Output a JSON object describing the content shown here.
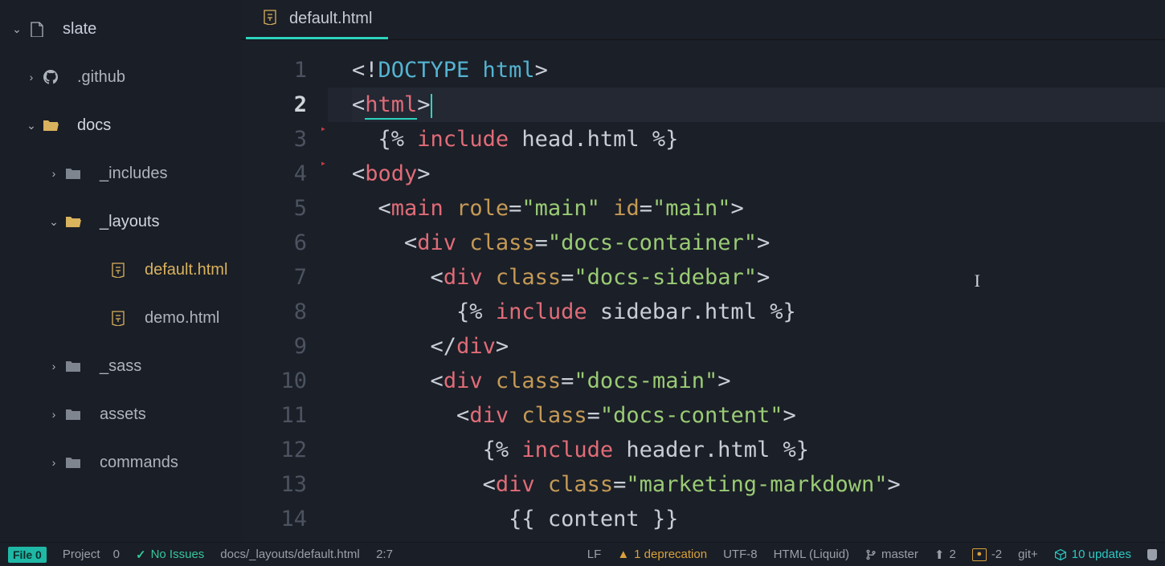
{
  "project": {
    "name": "slate"
  },
  "tree": [
    {
      "label": "slate",
      "depth": 0,
      "icon": "book",
      "arrow": "down",
      "kind": "root"
    },
    {
      "label": ".github",
      "depth": 1,
      "icon": "github",
      "arrow": "right",
      "kind": "folder-closed"
    },
    {
      "label": "docs",
      "depth": 1,
      "icon": "folder-open",
      "arrow": "down",
      "kind": "folder-open"
    },
    {
      "label": "_includes",
      "depth": 2,
      "icon": "folder-closed",
      "arrow": "right",
      "kind": "folder-closed"
    },
    {
      "label": "_layouts",
      "depth": 2,
      "icon": "folder-open",
      "arrow": "down",
      "kind": "folder-open"
    },
    {
      "label": "default.html",
      "depth": 3,
      "icon": "html",
      "arrow": "",
      "kind": "file",
      "selected": true
    },
    {
      "label": "demo.html",
      "depth": 3,
      "icon": "html",
      "arrow": "",
      "kind": "file"
    },
    {
      "label": "_sass",
      "depth": 2,
      "icon": "folder-closed",
      "arrow": "right",
      "kind": "folder-closed"
    },
    {
      "label": "assets",
      "depth": 2,
      "icon": "folder-closed",
      "arrow": "right",
      "kind": "folder-closed"
    },
    {
      "label": "commands",
      "depth": 2,
      "icon": "folder-closed",
      "arrow": "right",
      "kind": "folder-closed"
    }
  ],
  "editor": {
    "tabs": [
      {
        "label": "default.html",
        "icon": "html",
        "active": true
      }
    ],
    "current_line": 2,
    "fold_markers_after": [
      2,
      3
    ],
    "lines": [
      [
        {
          "c": "t-pun",
          "t": "<!"
        },
        {
          "c": "t-doct",
          "t": "DOCTYPE html"
        },
        {
          "c": "t-pun",
          "t": ">"
        }
      ],
      [
        {
          "c": "t-pun",
          "t": "<"
        },
        {
          "c": "t-tag u",
          "t": "html"
        },
        {
          "c": "t-pun",
          "t": ">"
        },
        {
          "c": "cursor",
          "t": ""
        }
      ],
      [
        {
          "c": "t-plain",
          "t": "  "
        },
        {
          "c": "t-pun",
          "t": "{% "
        },
        {
          "c": "t-key",
          "t": "include"
        },
        {
          "c": "t-plain",
          "t": " head.html "
        },
        {
          "c": "t-pun",
          "t": "%}"
        }
      ],
      [
        {
          "c": "t-pun",
          "t": "<"
        },
        {
          "c": "t-tag",
          "t": "body"
        },
        {
          "c": "t-pun",
          "t": ">"
        }
      ],
      [
        {
          "c": "t-plain",
          "t": "  "
        },
        {
          "c": "t-pun",
          "t": "<"
        },
        {
          "c": "t-tag",
          "t": "main"
        },
        {
          "c": "t-plain",
          "t": " "
        },
        {
          "c": "t-attr",
          "t": "role"
        },
        {
          "c": "t-pun",
          "t": "="
        },
        {
          "c": "t-str",
          "t": "\"main\""
        },
        {
          "c": "t-plain",
          "t": " "
        },
        {
          "c": "t-attr",
          "t": "id"
        },
        {
          "c": "t-pun",
          "t": "="
        },
        {
          "c": "t-str",
          "t": "\"main\""
        },
        {
          "c": "t-pun",
          "t": ">"
        }
      ],
      [
        {
          "c": "t-plain",
          "t": "    "
        },
        {
          "c": "t-pun",
          "t": "<"
        },
        {
          "c": "t-tag",
          "t": "div"
        },
        {
          "c": "t-plain",
          "t": " "
        },
        {
          "c": "t-attr",
          "t": "class"
        },
        {
          "c": "t-pun",
          "t": "="
        },
        {
          "c": "t-str",
          "t": "\"docs-container\""
        },
        {
          "c": "t-pun",
          "t": ">"
        }
      ],
      [
        {
          "c": "t-plain",
          "t": "      "
        },
        {
          "c": "t-pun",
          "t": "<"
        },
        {
          "c": "t-tag",
          "t": "div"
        },
        {
          "c": "t-plain",
          "t": " "
        },
        {
          "c": "t-attr",
          "t": "class"
        },
        {
          "c": "t-pun",
          "t": "="
        },
        {
          "c": "t-str",
          "t": "\"docs-sidebar\""
        },
        {
          "c": "t-pun",
          "t": ">"
        }
      ],
      [
        {
          "c": "t-plain",
          "t": "        "
        },
        {
          "c": "t-pun",
          "t": "{% "
        },
        {
          "c": "t-key",
          "t": "include"
        },
        {
          "c": "t-plain",
          "t": " sidebar.html "
        },
        {
          "c": "t-pun",
          "t": "%}"
        }
      ],
      [
        {
          "c": "t-plain",
          "t": "      "
        },
        {
          "c": "t-pun",
          "t": "</"
        },
        {
          "c": "t-tag",
          "t": "div"
        },
        {
          "c": "t-pun",
          "t": ">"
        }
      ],
      [
        {
          "c": "t-plain",
          "t": "      "
        },
        {
          "c": "t-pun",
          "t": "<"
        },
        {
          "c": "t-tag",
          "t": "div"
        },
        {
          "c": "t-plain",
          "t": " "
        },
        {
          "c": "t-attr",
          "t": "class"
        },
        {
          "c": "t-pun",
          "t": "="
        },
        {
          "c": "t-str",
          "t": "\"docs-main\""
        },
        {
          "c": "t-pun",
          "t": ">"
        }
      ],
      [
        {
          "c": "t-plain",
          "t": "        "
        },
        {
          "c": "t-pun",
          "t": "<"
        },
        {
          "c": "t-tag",
          "t": "div"
        },
        {
          "c": "t-plain",
          "t": " "
        },
        {
          "c": "t-attr",
          "t": "class"
        },
        {
          "c": "t-pun",
          "t": "="
        },
        {
          "c": "t-str",
          "t": "\"docs-content\""
        },
        {
          "c": "t-pun",
          "t": ">"
        }
      ],
      [
        {
          "c": "t-plain",
          "t": "          "
        },
        {
          "c": "t-pun",
          "t": "{% "
        },
        {
          "c": "t-key",
          "t": "include"
        },
        {
          "c": "t-plain",
          "t": " header.html "
        },
        {
          "c": "t-pun",
          "t": "%}"
        }
      ],
      [
        {
          "c": "t-plain",
          "t": "          "
        },
        {
          "c": "t-pun",
          "t": "<"
        },
        {
          "c": "t-tag",
          "t": "div"
        },
        {
          "c": "t-plain",
          "t": " "
        },
        {
          "c": "t-attr",
          "t": "class"
        },
        {
          "c": "t-pun",
          "t": "="
        },
        {
          "c": "t-str",
          "t": "\"marketing-markdown\""
        },
        {
          "c": "t-pun",
          "t": ">"
        }
      ],
      [
        {
          "c": "t-plain",
          "t": "            "
        },
        {
          "c": "t-pun",
          "t": "{{ "
        },
        {
          "c": "t-plain",
          "t": "content"
        },
        {
          "c": "t-pun",
          "t": " }}"
        }
      ]
    ]
  },
  "status_bar": {
    "file_label": "File",
    "file_count": "0",
    "project_label": "Project",
    "project_count": "0",
    "issues": "No Issues",
    "path": "docs/_layouts/default.html",
    "cursor_pos": "2:7",
    "line_ending": "LF",
    "warning": "1 deprecation",
    "encoding": "UTF-8",
    "language": "HTML (Liquid)",
    "branch": "master",
    "ahead": "2",
    "behind": "-2",
    "git_label": "git+",
    "updates": "10 updates"
  }
}
